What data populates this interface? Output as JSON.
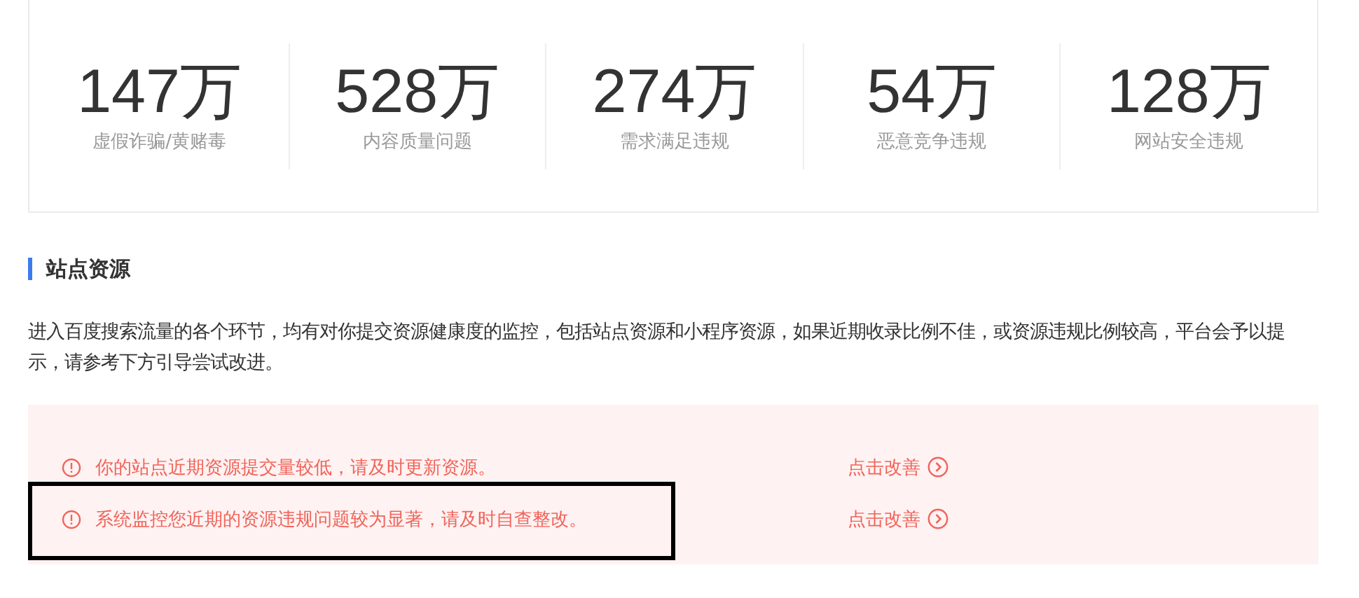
{
  "stats": [
    {
      "value": "147万",
      "label": "虚假诈骗/黄赌毒"
    },
    {
      "value": "528万",
      "label": "内容质量问题"
    },
    {
      "value": "274万",
      "label": "需求满足违规"
    },
    {
      "value": "54万",
      "label": "恶意竞争违规"
    },
    {
      "value": "128万",
      "label": "网站安全违规"
    }
  ],
  "section": {
    "title": "站点资源",
    "description": "进入百度搜索流量的各个环节，均有对你提交资源健康度的监控，包括站点资源和小程序资源，如果近期收录比例不佳，或资源违规比例较高，平台会予以提示，请参考下方引导尝试改进。"
  },
  "alerts": [
    {
      "message": "你的站点近期资源提交量较低，请及时更新资源。",
      "action": "点击改善",
      "highlighted": false
    },
    {
      "message": "系统监控您近期的资源违规问题较为显著，请及时自查整改。",
      "action": "点击改善",
      "highlighted": true
    }
  ]
}
